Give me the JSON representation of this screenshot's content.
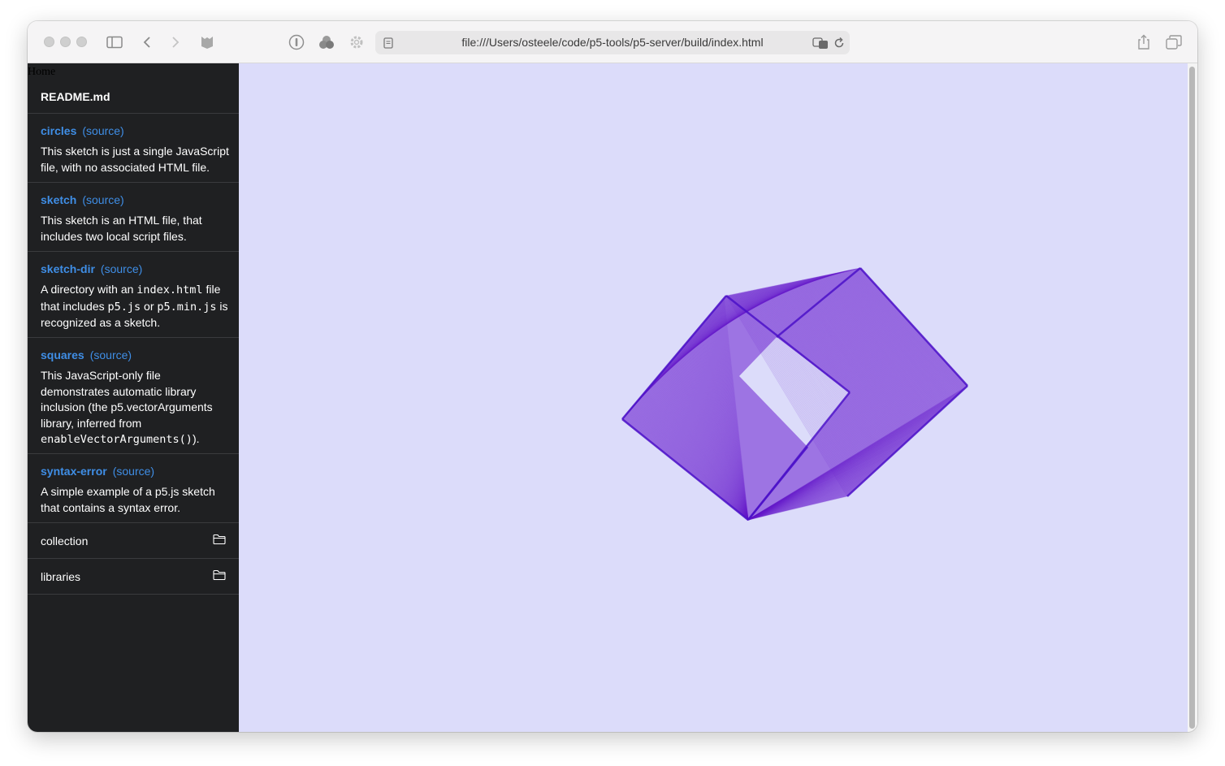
{
  "browser": {
    "url": "file:///Users/osteele/code/p5-tools/p5-server/build/index.html"
  },
  "sidebar": {
    "home_link": "Home",
    "readme": "README.md",
    "source_label": "(source)",
    "entries": [
      {
        "title": "circles",
        "source": "(source)",
        "desc_parts": [
          "This sketch is just a single JavaScript file, with no associated HTML file."
        ]
      },
      {
        "title": "sketch",
        "source": "(source)",
        "desc_parts": [
          "This sketch is an HTML file, that includes two local script files."
        ]
      },
      {
        "title": "sketch-dir",
        "source": "(source)",
        "desc_parts": [
          "A directory with an ",
          "index.html",
          " file that includes ",
          "p5.js",
          " or ",
          "p5.min.js",
          " is recognized as a sketch."
        ]
      },
      {
        "title": "squares",
        "source": "(source)",
        "desc_parts": [
          "This JavaScript-only file demonstrates automatic library inclusion (the p5.vectorArguments library, inferred from ",
          "enableVectorArguments()",
          ")."
        ]
      },
      {
        "title": "syntax-error",
        "source": "(source)",
        "desc_parts": [
          "A simple example of a p5.js sketch that contains a syntax error."
        ]
      }
    ],
    "folders": [
      "collection",
      "libraries"
    ]
  },
  "colors": {
    "sidebar_bg": "#1f2022",
    "link": "#3f8ee6",
    "canvas_bg": "#dcdcfa",
    "shape": "#6a1fd0"
  }
}
